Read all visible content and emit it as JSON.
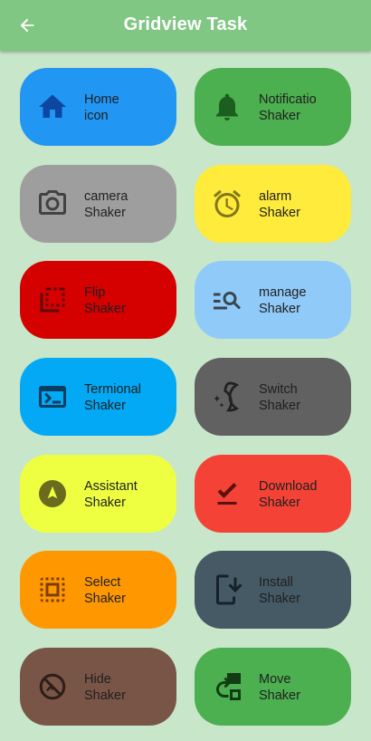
{
  "appbar": {
    "title": "Gridview Task"
  },
  "tiles": [
    {
      "line1": "Home",
      "line2": "icon",
      "icon": "home-icon",
      "color": "#2196f3"
    },
    {
      "line1": "Notificatio",
      "line2": "Shaker",
      "icon": "notification-bell-icon",
      "color": "#4caf50"
    },
    {
      "line1": "camera",
      "line2": "Shaker",
      "icon": "camera-icon",
      "color": "#9e9e9e"
    },
    {
      "line1": "alarm",
      "line2": "Shaker",
      "icon": "alarm-clock-icon",
      "color": "#ffeb3b"
    },
    {
      "line1": "Flip",
      "line2": "Shaker",
      "icon": "flip-icon",
      "color": "#d50000"
    },
    {
      "line1": "manage",
      "line2": "Shaker",
      "icon": "manage-search-icon",
      "color": "#90caf9"
    },
    {
      "line1": "Termional",
      "line2": "Shaker",
      "icon": "terminal-icon",
      "color": "#03a9f4"
    },
    {
      "line1": "Switch",
      "line2": "Shaker",
      "icon": "dark-mode-switch-icon",
      "color": "#616161"
    },
    {
      "line1": "Assistant",
      "line2": "Shaker",
      "icon": "assistant-navigation-icon",
      "color": "#eeff41"
    },
    {
      "line1": "Download",
      "line2": "Shaker",
      "icon": "download-done-icon",
      "color": "#f44336"
    },
    {
      "line1": "Select",
      "line2": "Shaker",
      "icon": "select-all-icon",
      "color": "#ff9800"
    },
    {
      "line1": "Install",
      "line2": "Shaker",
      "icon": "install-mobile-icon",
      "color": "#455a64"
    },
    {
      "line1": "Hide",
      "line2": "Shaker",
      "icon": "hide-image-icon",
      "color": "#795548"
    },
    {
      "line1": "Move",
      "line2": "Shaker",
      "icon": "move-icon",
      "color": "#4caf50"
    }
  ]
}
